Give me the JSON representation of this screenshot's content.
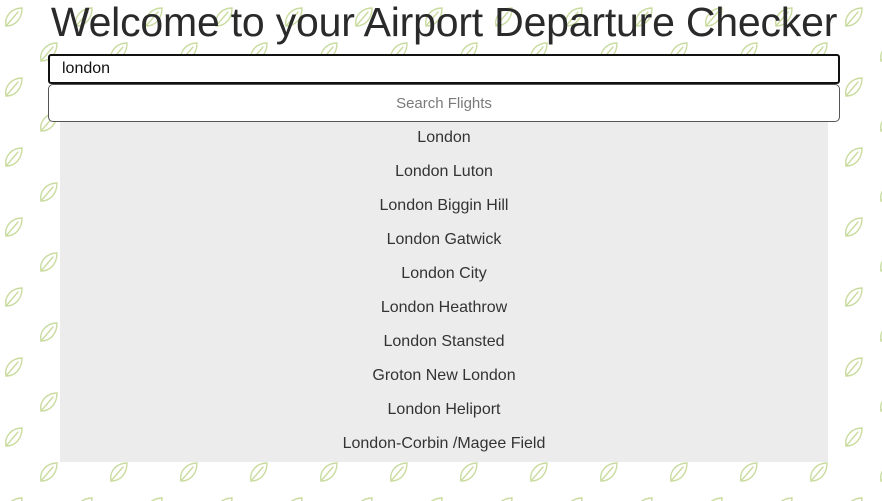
{
  "page": {
    "title": "Welcome to your Airport Departure Checker"
  },
  "search": {
    "value": "london",
    "button_label": "Search Flights"
  },
  "suggestions": [
    "London",
    "London Luton",
    "London Biggin Hill",
    "London Gatwick",
    "London City",
    "London Heathrow",
    "London Stansted",
    "Groton New London",
    "London Heliport",
    "London-Corbin /Magee Field"
  ],
  "colors": {
    "background": "#ffffff",
    "leaf_pattern": "#c9dca0",
    "dropdown_background": "#ececec",
    "input_border": "#111111"
  },
  "icons": {
    "background_pattern": "leaf-icon"
  }
}
